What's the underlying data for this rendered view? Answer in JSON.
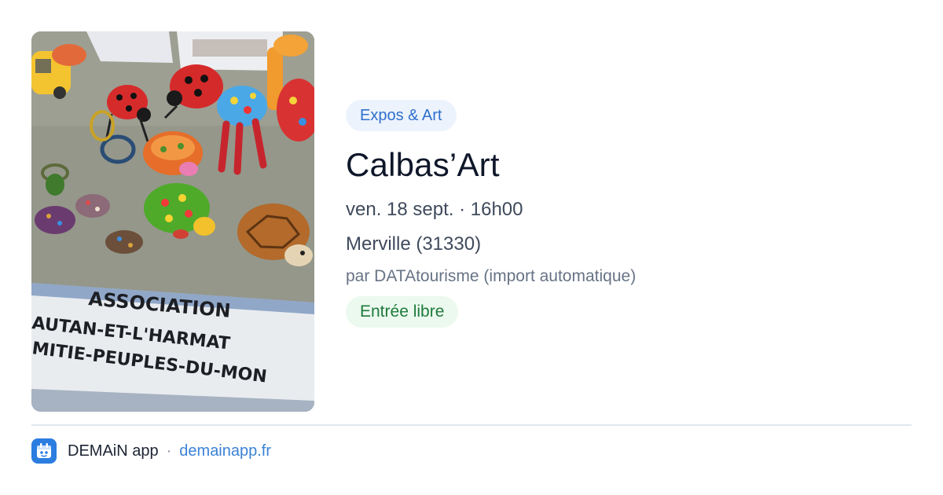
{
  "image": {
    "banner_lines": [
      "ASSOCIATION",
      "AUTAN-ET-L'HARMAT",
      "MITIE-PEUPLES-DU-MON"
    ]
  },
  "event": {
    "category": "Expos & Art",
    "title": "Calbas’Art",
    "date_time": "ven. 18 sept. · 16h00",
    "location": "Merville (31330)",
    "organizer": "par DATAtourisme (import automatique)",
    "price": "Entrée libre"
  },
  "footer": {
    "app_name": "DEMAiN app",
    "separator": "·",
    "url": "demainapp.fr"
  },
  "colors": {
    "category_chip_bg": "#ecf3fd",
    "category_chip_text": "#2f6fcb",
    "free_chip_bg": "#ecf9ef",
    "free_chip_text": "#1e7a3c",
    "app_icon": "#2b7de0",
    "link": "#3b82d6"
  },
  "icons": {
    "app": "app-logo-icon"
  }
}
